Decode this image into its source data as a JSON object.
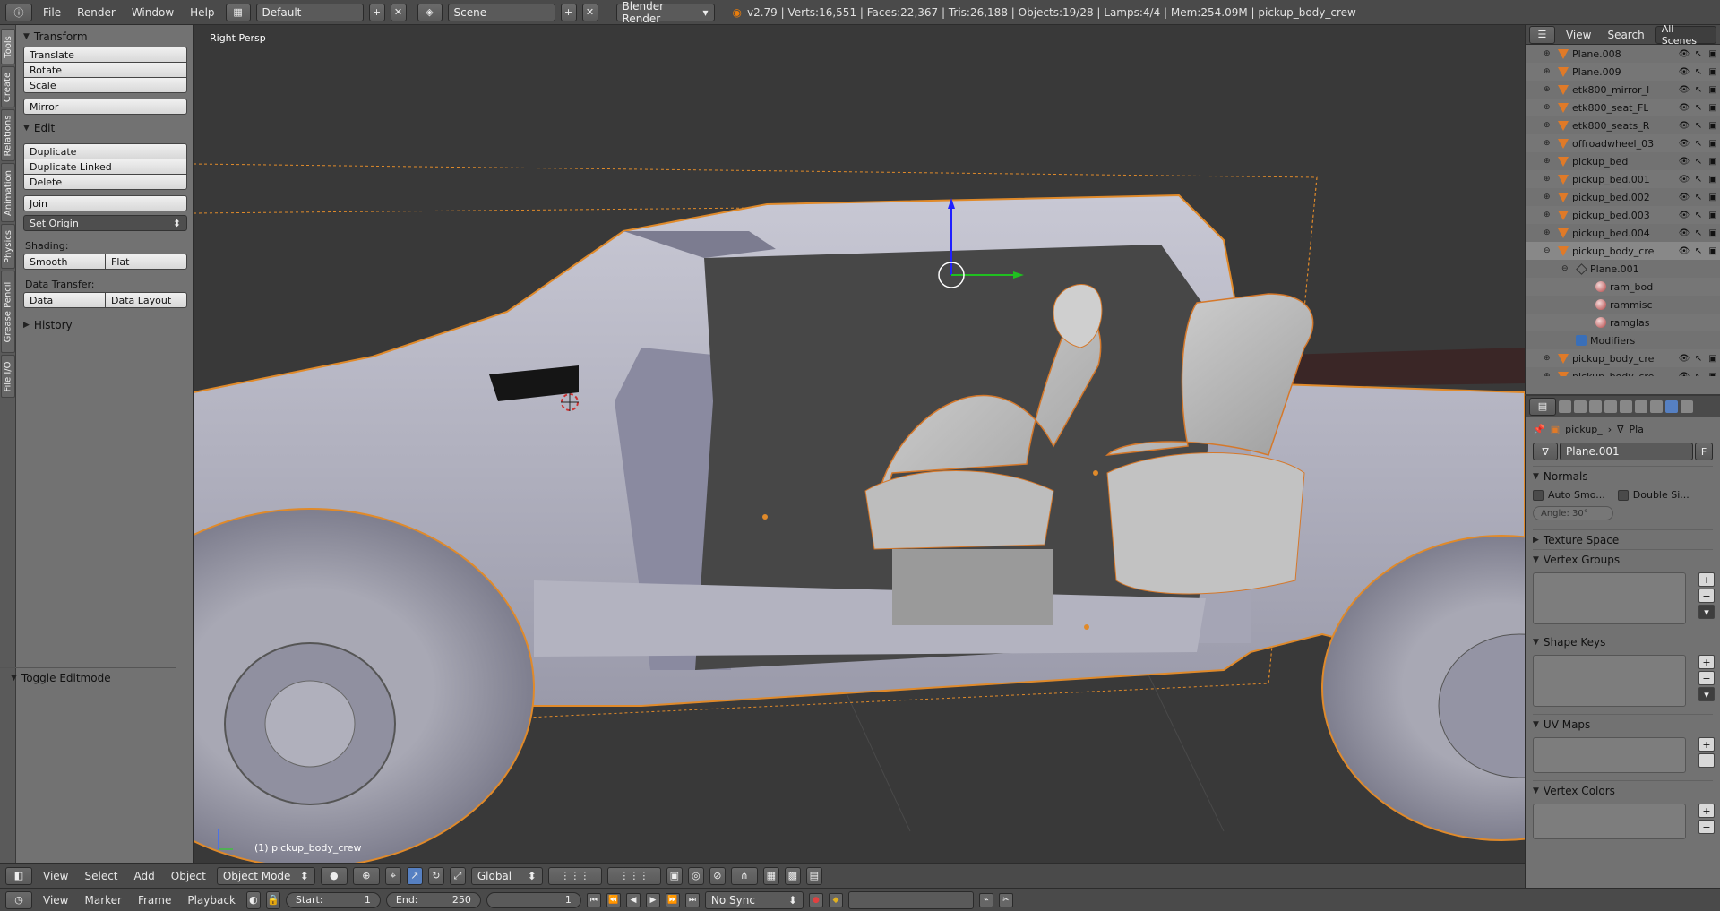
{
  "topbar": {
    "menus": [
      "File",
      "Render",
      "Window",
      "Help"
    ],
    "layout": "Default",
    "scene": "Scene",
    "engine": "Blender Render",
    "stats": "v2.79 | Verts:16,551 | Faces:22,367 | Tris:26,188 | Objects:19/28 | Lamps:4/4 | Mem:254.09M | pickup_body_crew"
  },
  "toolshelf": {
    "tabs": [
      "Tools",
      "Create",
      "Relations",
      "Animation",
      "Physics",
      "Grease Pencil",
      "File I/O"
    ],
    "transform": {
      "title": "Transform",
      "buttons": [
        "Translate",
        "Rotate",
        "Scale"
      ],
      "mirror": "Mirror"
    },
    "edit": {
      "title": "Edit",
      "buttons": [
        "Duplicate",
        "Duplicate Linked",
        "Delete"
      ],
      "join": "Join",
      "set_origin": "Set Origin",
      "shading_label": "Shading:",
      "smooth": "Smooth",
      "flat": "Flat",
      "data_transfer_label": "Data Transfer:",
      "data": "Data",
      "data_layout": "Data Layout"
    },
    "history": "History",
    "operator_panel": "Toggle Editmode"
  },
  "viewport": {
    "view_label": "Right Persp",
    "object_label": "(1) pickup_body_crew"
  },
  "outliner": {
    "menus": [
      "View",
      "Search"
    ],
    "filter": "All Scenes",
    "rows": [
      {
        "name": "Plane.008",
        "type": "mesh"
      },
      {
        "name": "Plane.009",
        "type": "mesh"
      },
      {
        "name": "etk800_mirror_l",
        "type": "mesh"
      },
      {
        "name": "etk800_seat_FL",
        "type": "mesh"
      },
      {
        "name": "etk800_seats_R",
        "type": "mesh"
      },
      {
        "name": "offroadwheel_03",
        "type": "mesh"
      },
      {
        "name": "pickup_bed",
        "type": "mesh"
      },
      {
        "name": "pickup_bed.001",
        "type": "mesh"
      },
      {
        "name": "pickup_bed.002",
        "type": "mesh"
      },
      {
        "name": "pickup_bed.003",
        "type": "mesh"
      },
      {
        "name": "pickup_bed.004",
        "type": "mesh"
      },
      {
        "name": "pickup_body_cre",
        "type": "mesh"
      },
      {
        "name": "Plane.001",
        "type": "data"
      },
      {
        "name": "ram_bod",
        "type": "material"
      },
      {
        "name": "rammisc",
        "type": "material"
      },
      {
        "name": "ramglas",
        "type": "material"
      },
      {
        "name": "Modifiers",
        "type": "modifier"
      },
      {
        "name": "pickup_body_cre",
        "type": "mesh"
      },
      {
        "name": "pickup_body_cre",
        "type": "mesh"
      }
    ]
  },
  "properties": {
    "breadcrumb_object": "pickup_",
    "breadcrumb_data": "Pla",
    "datablock": "Plane.001",
    "fake_user": "F",
    "normals": {
      "title": "Normals",
      "auto_smooth": "Auto Smo...",
      "double_sided": "Double Si...",
      "angle": "Angle: 30°"
    },
    "texture_space": "Texture Space",
    "vertex_groups": "Vertex Groups",
    "shape_keys": "Shape Keys",
    "uv_maps": "UV Maps",
    "vertex_colors": "Vertex Colors"
  },
  "viewport_header": {
    "menus": [
      "View",
      "Select",
      "Add",
      "Object"
    ],
    "mode": "Object Mode",
    "orientation": "Global"
  },
  "timeline": {
    "menus": [
      "View",
      "Marker",
      "Frame",
      "Playback"
    ],
    "start_label": "Start:",
    "start": "1",
    "end_label": "End:",
    "end": "250",
    "current": "1",
    "sync": "No Sync"
  },
  "colors": {
    "accent": "#5680c2",
    "selection_outline": "#e08a2a",
    "panel_bg": "#727272",
    "header_bg": "#4a4a4a"
  }
}
